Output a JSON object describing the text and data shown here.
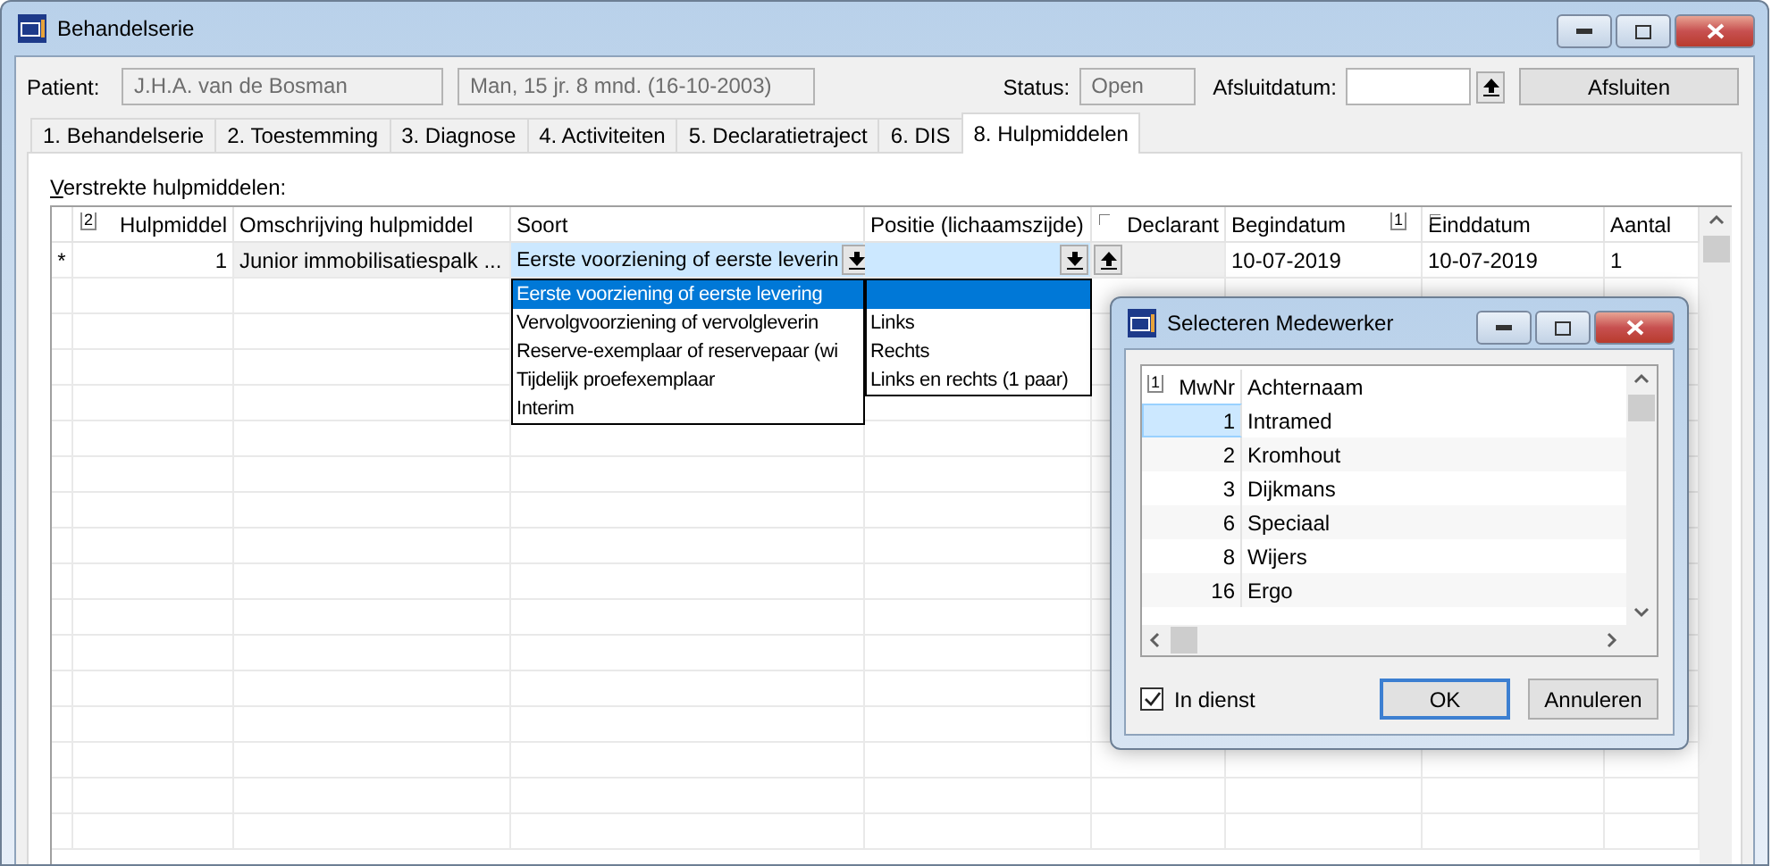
{
  "window": {
    "title": "Behandelserie"
  },
  "header": {
    "patient_label": "Patient:",
    "patient_name": "J.H.A. van de Bosman",
    "patient_info": "Man, 15 jr. 8 mnd. (16-10-2003)",
    "status_label": "Status:",
    "status": "Open",
    "closing_date_label": "Afsluitdatum:",
    "close_button": "Afsluiten"
  },
  "tabs": [
    {
      "label": "1. Behandelserie",
      "selected": false
    },
    {
      "label": "2. Toestemming",
      "selected": false
    },
    {
      "label": "3. Diagnose",
      "selected": false
    },
    {
      "label": "4. Activiteiten",
      "selected": false
    },
    {
      "label": "5. Declaratietraject",
      "selected": false
    },
    {
      "label": "6. DIS",
      "selected": false
    },
    {
      "label": "8. Hulpmiddelen",
      "selected": true
    }
  ],
  "section_label": "Verstrekte hulpmiddelen:",
  "table": {
    "sort_mark": "2",
    "columns": [
      {
        "label": "Hulpmiddel",
        "corner_mark": false
      },
      {
        "label": "Omschrijving hulpmiddel",
        "corner_mark": false
      },
      {
        "label": "Soort",
        "corner_mark": false
      },
      {
        "label": "Positie (lichaamszijde)",
        "corner_mark": false
      },
      {
        "label": "Declarant",
        "corner_mark": true
      },
      {
        "label": "Begindatum",
        "sort_mark": "1",
        "corner_mark": false
      },
      {
        "label": "Einddatum",
        "corner_mark": true
      },
      {
        "label": "Aantal",
        "corner_mark": false
      }
    ],
    "row": {
      "marker": "*",
      "hulpmiddel": "1",
      "omschrijving": "Junior immobilisatiespalk ...",
      "soort": "Eerste voorziening of eerste leverin",
      "begindatum": "10-07-2019",
      "einddatum": "10-07-2019",
      "aantal": "1"
    }
  },
  "soort_options": [
    {
      "label": "Eerste voorziening of eerste levering",
      "selected": true
    },
    {
      "label": "Vervolgvoorziening of vervolgleverin",
      "selected": false
    },
    {
      "label": "Reserve-exemplaar of reservepaar (wi",
      "selected": false
    },
    {
      "label": "Tijdelijk proefexemplaar",
      "selected": false
    },
    {
      "label": "Interim",
      "selected": false
    }
  ],
  "positie_options": [
    {
      "selected": true
    },
    {
      "label": "Links",
      "selected": false
    },
    {
      "label": "Rechts",
      "selected": false
    },
    {
      "label": "Links en rechts (1 paar)",
      "selected": false
    }
  ],
  "dialog": {
    "title": "Selecteren Medewerker",
    "sort_mark": "1",
    "columns": [
      "MwNr",
      "Achternaam"
    ],
    "rows": [
      {
        "number": "1",
        "name": "Intramed",
        "selected": true
      },
      {
        "number": "2",
        "name": "Kromhout",
        "selected": false
      },
      {
        "number": "3",
        "name": "Dijkmans",
        "selected": false
      },
      {
        "number": "6",
        "name": "Speciaal",
        "selected": false
      },
      {
        "number": "8",
        "name": "Wijers",
        "selected": false
      },
      {
        "number": "16",
        "name": "Ergo",
        "selected": false
      }
    ],
    "checkbox": {
      "label": "In dienst",
      "checked": true
    },
    "ok_button": "OK",
    "cancel_button": "Annuleren"
  }
}
